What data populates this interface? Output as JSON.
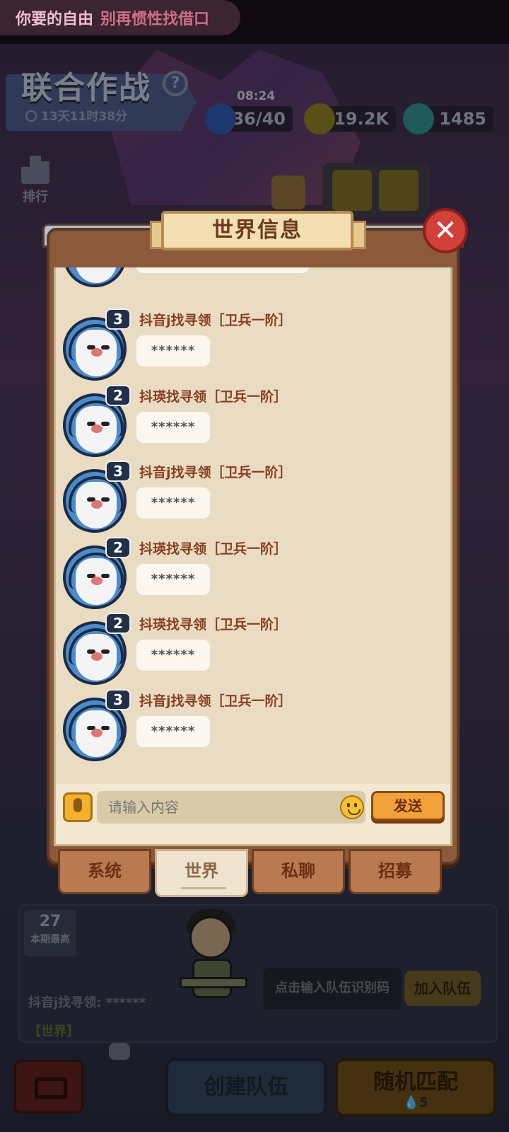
{
  "status_banner": {
    "text_a": "你要的自由",
    "text_b": "别再惯性找借口"
  },
  "event": {
    "title": "联合作战",
    "help": "?",
    "timer": "13天11时38分"
  },
  "resources": {
    "energy_timer": "08:24",
    "energy": "36/40",
    "coins": "19.2K",
    "gems": "1485"
  },
  "rank": {
    "label": "排行"
  },
  "modal": {
    "title": "世界信息",
    "close": "✕"
  },
  "messages": [
    {
      "level": "3",
      "sender": "抖音j找寻领［卫兵一阶］",
      "text": "******"
    },
    {
      "level": "2",
      "sender": "抖瑛找寻领［卫兵一阶］",
      "text": "******"
    },
    {
      "level": "3",
      "sender": "抖音j找寻领［卫兵一阶］",
      "text": "******"
    },
    {
      "level": "2",
      "sender": "抖瑛找寻领［卫兵一阶］",
      "text": "******"
    },
    {
      "level": "2",
      "sender": "抖瑛找寻领［卫兵一阶］",
      "text": "******"
    },
    {
      "level": "3",
      "sender": "抖音j找寻领［卫兵一阶］",
      "text": "******"
    }
  ],
  "input": {
    "placeholder": "请输入内容",
    "send": "发送"
  },
  "tabs": [
    "系统",
    "世界",
    "私聊",
    "招募"
  ],
  "team": {
    "best_num": "27",
    "best_label": "本期最高",
    "code_placeholder": "点击输入队伍识别码",
    "join": "加入队伍"
  },
  "ticker": {
    "tag": "【世界】",
    "msg": "抖音j找寻领: ******"
  },
  "buttons": {
    "create": "创建队伍",
    "random": "随机匹配",
    "random_cost": "5"
  }
}
